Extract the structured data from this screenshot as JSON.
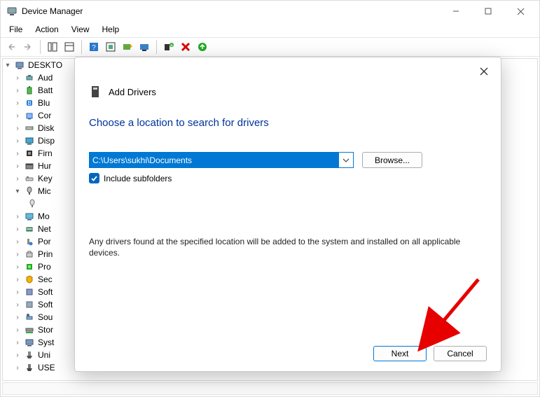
{
  "window": {
    "title": "Device Manager",
    "menus": [
      "File",
      "Action",
      "View",
      "Help"
    ]
  },
  "tree": {
    "root": "DESKTO",
    "items": [
      {
        "label": "Aud"
      },
      {
        "label": "Batt"
      },
      {
        "label": "Blu"
      },
      {
        "label": "Cor"
      },
      {
        "label": "Disk"
      },
      {
        "label": "Disp"
      },
      {
        "label": "Firn"
      },
      {
        "label": "Hur"
      },
      {
        "label": "Key"
      },
      {
        "label": "Mic",
        "expanded": true
      },
      {
        "label": "",
        "child": true
      },
      {
        "label": "Mo"
      },
      {
        "label": "Net"
      },
      {
        "label": "Por"
      },
      {
        "label": "Prin"
      },
      {
        "label": "Pro"
      },
      {
        "label": "Sec"
      },
      {
        "label": "Soft"
      },
      {
        "label": "Soft"
      },
      {
        "label": "Sou"
      },
      {
        "label": "Stor"
      },
      {
        "label": "Syst"
      },
      {
        "label": "Uni"
      },
      {
        "label": "USE"
      }
    ]
  },
  "dialog": {
    "title": "Add Drivers",
    "heading": "Choose a location to search for drivers",
    "path": "C:\\Users\\sukhi\\Documents",
    "browse": "Browse...",
    "include_subfolders": "Include subfolders",
    "info": "Any drivers found at the specified location will be added to the system and installed on all applicable devices.",
    "next": "Next",
    "cancel": "Cancel"
  }
}
